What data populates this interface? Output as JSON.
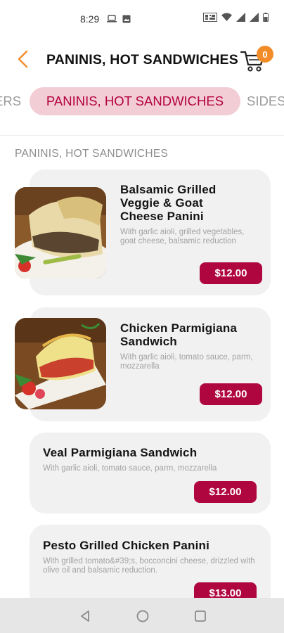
{
  "status_bar": {
    "time": "8:29",
    "icons": [
      "laptop-icon",
      "image-icon",
      "qr-icon",
      "wifi-icon",
      "signal-icon",
      "signal-icon",
      "battery-icon"
    ]
  },
  "header": {
    "title": "PANINIS, HOT SANDWICHES",
    "cart_count": "0"
  },
  "tabs": [
    {
      "label": "ERS"
    },
    {
      "label": "PANINIS, HOT SANDWICHES"
    },
    {
      "label": "SIDES"
    }
  ],
  "section": {
    "title": "PANINIS, HOT SANDWICHES"
  },
  "items": [
    {
      "name": "Balsamic Grilled Veggie & Goat Cheese Panini",
      "description": "With garlic aioli, grilled vegetables, goat cheese, balsamic reduction",
      "price": "$12.00"
    },
    {
      "name": "Chicken Parmigiana Sandwich",
      "description": "With garlic aioli, tomato sauce, parm, mozzarella",
      "price": "$12.00"
    },
    {
      "name": "Veal Parmigiana Sandwich",
      "description": "With garlic aioli, tomato sauce, parm, mozzarella",
      "price": "$12.00"
    },
    {
      "name": "Pesto Grilled Chicken Panini",
      "description": "With grilled tomato&#39;s, bocconcini cheese, drizzled with olive oil and balsamic reduction.",
      "price": "$13.00"
    }
  ],
  "colors": {
    "accent": "#b0063f",
    "tab_active_bg": "#f2cdd6",
    "badge": "#f28c28",
    "back_arrow": "#f28c28",
    "card_bg": "#f1f1f1"
  }
}
